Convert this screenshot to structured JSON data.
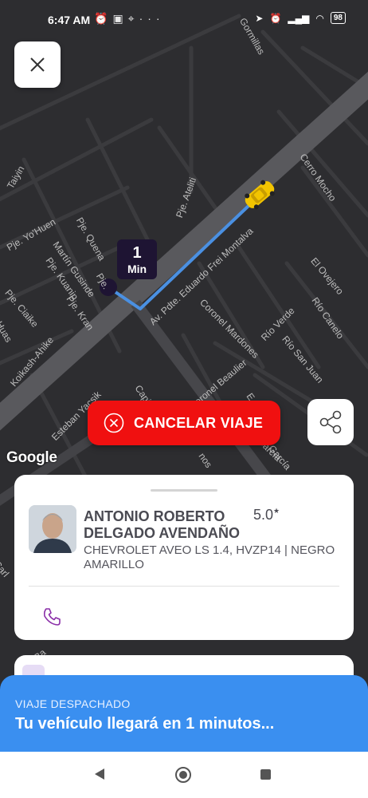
{
  "status_bar": {
    "time": "6:47 AM",
    "battery": "98",
    "left_icons": [
      "alarm-icon",
      "teams-icon",
      "location-pin-icon",
      "more-icon"
    ],
    "right_icons": [
      "navigation-icon",
      "alarm-icon",
      "signal-icon",
      "wifi-icon",
      "battery-icon"
    ]
  },
  "map": {
    "eta_marker": {
      "value": "1",
      "unit": "Min"
    },
    "streets": [
      "Gormillas",
      "Taiyin",
      "Pje. Ateliti",
      "Cerro Mocho",
      "Pje. Yo'Huen",
      "Pje. Quena",
      "Martín Gusinde",
      "Pje. Kuanip",
      "Pje.",
      "Av. Pdte. Eduardo Frei Montalva",
      "El Ovejero",
      "Pje. Kran",
      "Pje. Ciaike",
      "Huas",
      "Koikash-Ahike",
      "Coronel Mardones",
      "Río Verde",
      "Río Canelo",
      "Río San Juan",
      "Coronel Beaulier",
      "Esteban Yacsik",
      "Capit",
      "Juana García",
      "García",
      "E",
      "nos",
      "Ba",
      "Carl"
    ],
    "route_color": "#4a90e2",
    "taxi_color": "#f2c400"
  },
  "close_button": {
    "icon": "close-icon"
  },
  "cancel_button": {
    "label": "CANCELAR VIAJE",
    "icon": "close-circle-icon",
    "color": "#f01010"
  },
  "share_button": {
    "icon": "share-icon"
  },
  "google_logo": "Google",
  "driver": {
    "name": "ANTONIO ROBERTO DELGADO AVENDAÑO",
    "rating": "5.0",
    "rating_icon": "star-icon",
    "vehicle": "CHEVROLET AVEO LS 1.4, HVZP14 | NEGRO AMARILLO",
    "call_icon": "phone-icon"
  },
  "banner": {
    "status": "VIAJE DESPACHADO",
    "message": "Tu vehículo llegará en 1 minutos...",
    "color": "#3a8ff0"
  },
  "nav_bar": {
    "back": "back-icon",
    "home": "home-icon",
    "recents": "recents-icon"
  }
}
